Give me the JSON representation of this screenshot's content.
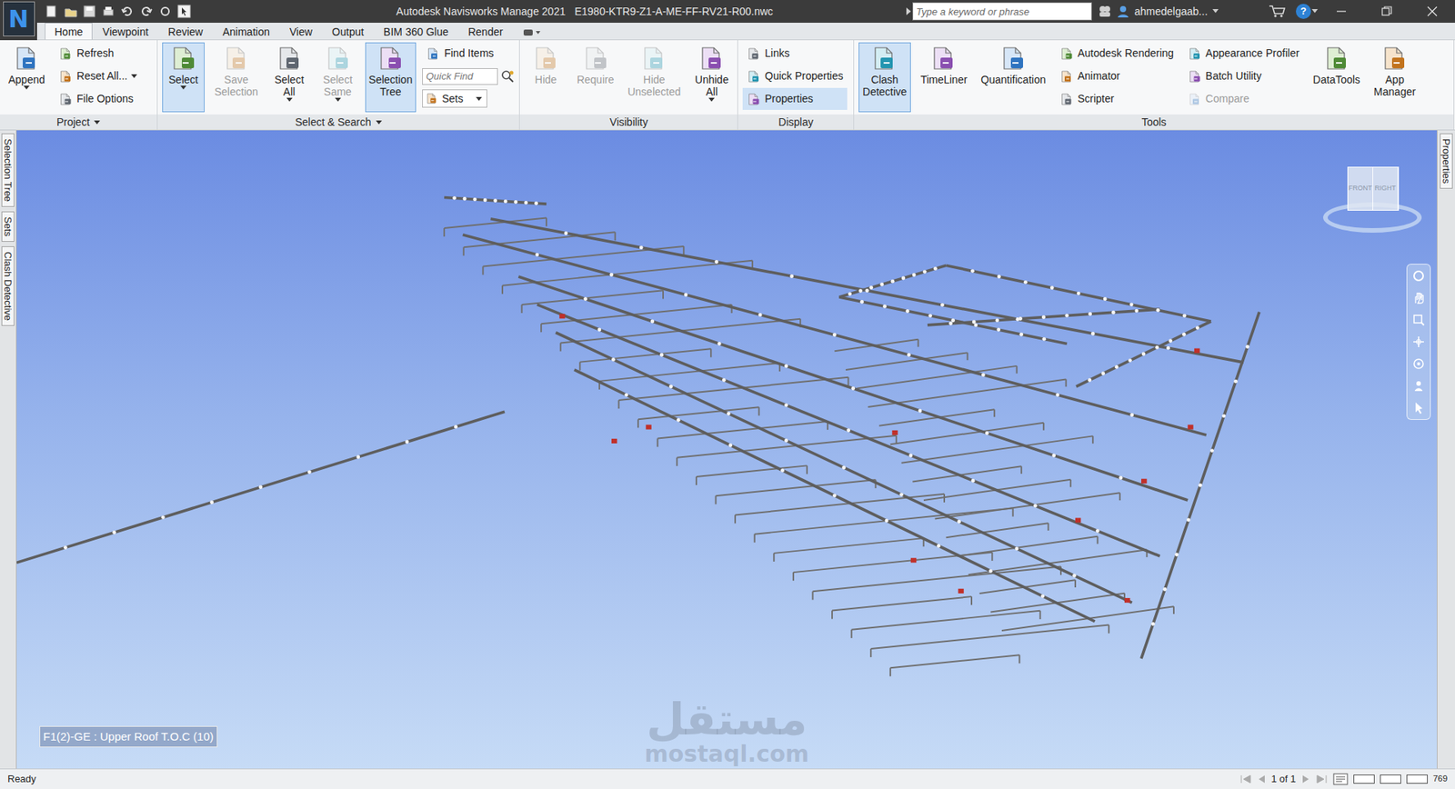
{
  "app_button": "N",
  "window": {
    "app_title": "Autodesk Navisworks Manage 2021",
    "file_name": "E1980-KTR9-Z1-A-ME-FF-RV21-R00.nwc"
  },
  "search": {
    "placeholder": "Type a keyword or phrase"
  },
  "user": {
    "name": "ahmedelgaab..."
  },
  "help": "?",
  "tabs": [
    {
      "label": "Home",
      "selected": true
    },
    {
      "label": "Viewpoint",
      "selected": false
    },
    {
      "label": "Review",
      "selected": false
    },
    {
      "label": "Animation",
      "selected": false
    },
    {
      "label": "View",
      "selected": false
    },
    {
      "label": "Output",
      "selected": false
    },
    {
      "label": "BIM 360 Glue",
      "selected": false
    },
    {
      "label": "Render",
      "selected": false
    }
  ],
  "panels": [
    {
      "label": "Project",
      "has_menu": true,
      "items": [
        {
          "kind": "large",
          "label": "Append",
          "disabled": false,
          "active": false,
          "has_menu": true
        },
        {
          "kind": "small",
          "label": "Refresh",
          "disabled": false,
          "active": false,
          "has_menu": false
        },
        {
          "kind": "small",
          "label": "Reset All...",
          "disabled": false,
          "active": false,
          "has_menu": true
        },
        {
          "kind": "small",
          "label": "File Options",
          "disabled": false,
          "active": false,
          "has_menu": false
        }
      ]
    },
    {
      "label": "Select & Search",
      "has_menu": true,
      "items": [
        {
          "kind": "large",
          "label": "Select",
          "disabled": false,
          "active": true,
          "has_menu": true
        },
        {
          "kind": "large",
          "label": "Save Selection",
          "disabled": true,
          "active": false,
          "has_menu": false
        },
        {
          "kind": "large",
          "label": "Select All",
          "disabled": false,
          "active": false,
          "has_menu": true
        },
        {
          "kind": "large",
          "label": "Select Same",
          "disabled": true,
          "active": false,
          "has_menu": true
        },
        {
          "kind": "large",
          "label": "Selection Tree",
          "disabled": false,
          "active": true,
          "has_menu": false
        },
        {
          "kind": "small",
          "label": "Find Items",
          "disabled": false,
          "active": false,
          "has_menu": false
        },
        {
          "kind": "field",
          "placeholder": "Quick Find",
          "disabled": false,
          "active": false,
          "has_menu": false
        },
        {
          "kind": "combo",
          "label": "Sets",
          "disabled": false,
          "active": false,
          "has_menu": true
        }
      ]
    },
    {
      "label": "Visibility",
      "has_menu": false,
      "items": [
        {
          "kind": "large",
          "label": "Hide",
          "disabled": true,
          "active": false,
          "has_menu": false
        },
        {
          "kind": "large",
          "label": "Require",
          "disabled": true,
          "active": false,
          "has_menu": false
        },
        {
          "kind": "large",
          "label": "Hide Unselected",
          "disabled": true,
          "active": false,
          "has_menu": false
        },
        {
          "kind": "large",
          "label": "Unhide All",
          "disabled": false,
          "active": false,
          "has_menu": true
        }
      ]
    },
    {
      "label": "Display",
      "has_menu": false,
      "items": [
        {
          "kind": "small",
          "label": "Links",
          "disabled": false,
          "active": false,
          "has_menu": false
        },
        {
          "kind": "small",
          "label": "Quick Properties",
          "disabled": false,
          "active": false,
          "has_menu": false
        },
        {
          "kind": "small",
          "label": "Properties",
          "disabled": false,
          "active": true,
          "has_menu": false
        }
      ]
    },
    {
      "label": "Tools",
      "has_menu": false,
      "items": [
        {
          "kind": "large",
          "label": "Clash Detective",
          "disabled": false,
          "active": true,
          "has_menu": false
        },
        {
          "kind": "large",
          "label": "TimeLiner",
          "disabled": false,
          "active": false,
          "has_menu": false
        },
        {
          "kind": "large",
          "label": "Quantification",
          "disabled": false,
          "active": false,
          "has_menu": false
        },
        {
          "kind": "small",
          "label": "Autodesk Rendering",
          "disabled": false,
          "active": false,
          "has_menu": false
        },
        {
          "kind": "small",
          "label": "Animator",
          "disabled": false,
          "active": false,
          "has_menu": false
        },
        {
          "kind": "small",
          "label": "Scripter",
          "disabled": false,
          "active": false,
          "has_menu": false
        },
        {
          "kind": "small",
          "label": "Appearance Profiler",
          "disabled": false,
          "active": false,
          "has_menu": false
        },
        {
          "kind": "small",
          "label": "Batch Utility",
          "disabled": false,
          "active": false,
          "has_menu": false
        },
        {
          "kind": "small",
          "label": "Compare",
          "disabled": true,
          "active": false,
          "has_menu": false
        },
        {
          "kind": "large",
          "label": "DataTools",
          "disabled": false,
          "active": false,
          "has_menu": false
        },
        {
          "kind": "large",
          "label": "App Manager",
          "disabled": false,
          "active": false,
          "has_menu": false
        }
      ]
    }
  ],
  "side_tabs_left": [
    {
      "label": "Selection Tree"
    },
    {
      "label": "Sets"
    },
    {
      "label": "Clash Detective"
    }
  ],
  "side_tabs_right": [
    {
      "label": "Properties"
    }
  ],
  "viewcube": {
    "faces": [
      "FRONT",
      "RIGHT"
    ]
  },
  "viewpoint_label": "F1(2)-GE : Upper Roof T.O.C (10)",
  "watermark": {
    "arabic": "مستقل",
    "latin": "mostaql.com"
  },
  "status_bar": {
    "status": "Ready",
    "page": "1 of 1",
    "memory": "769"
  }
}
